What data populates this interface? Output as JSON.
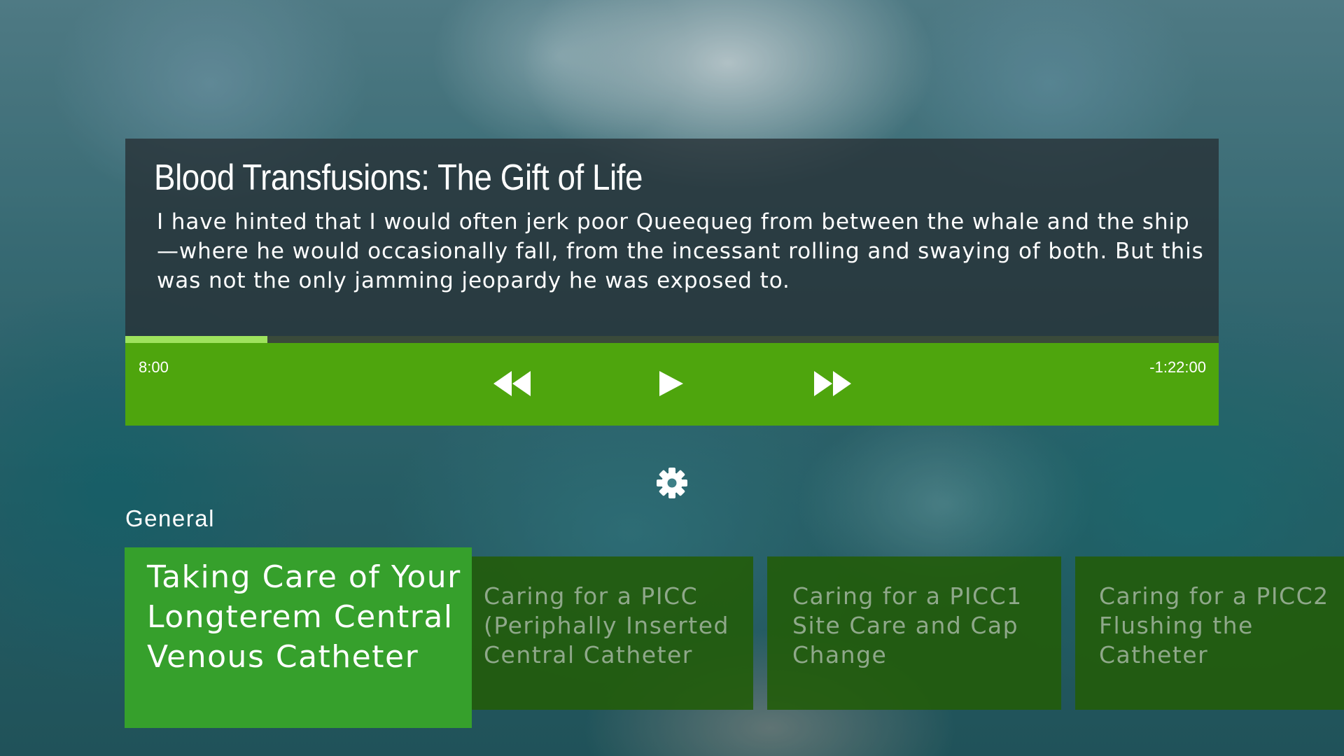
{
  "video": {
    "title": "Blood Transfusions: The Gift of Life",
    "description": "I have hinted that I would often jerk poor Queequeg from between the whale and the ship—where he would occasionally fall, from the incessant rolling and swaying of both. But this was not the only jamming jeopardy he was exposed to."
  },
  "player": {
    "elapsed": "8:00",
    "remaining": "-1:22:00",
    "progress_fraction": 0.13,
    "controls": [
      "rewind-icon",
      "play-icon",
      "fast-forward-icon"
    ],
    "accent_color": "#4ea50d",
    "progress_color": "#9ee35d"
  },
  "settings": {
    "icon": "gear-icon"
  },
  "category": {
    "label": "General",
    "items": [
      {
        "title": "Taking Care of Your Longterem Central Venous Catheter"
      },
      {
        "title": "Caring for a PICC (Periphally Inserted Central Catheter"
      },
      {
        "title": "Caring for a PICC1 Site Care and Cap Change"
      },
      {
        "title": "Caring for a PICC2 Flushing the Catheter"
      }
    ]
  }
}
